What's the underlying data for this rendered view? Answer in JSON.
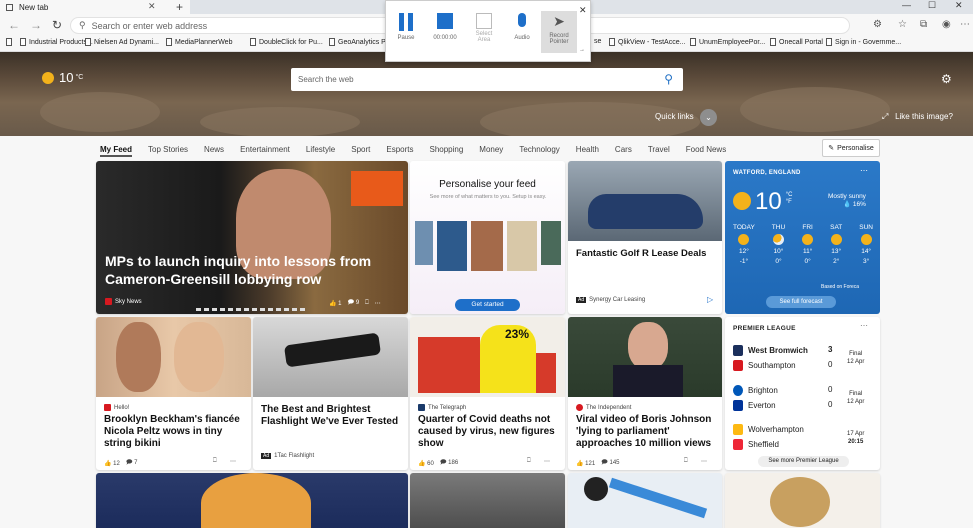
{
  "browser": {
    "tab_title": "New tab",
    "omnibox_placeholder": "Search or enter web address"
  },
  "favorites": [
    "Industrial Products...",
    "Nielsen Ad Dynami...",
    "MediaPlannerWeb",
    "DoubleClick for Pu...",
    "GeoAnalytics Plu",
    "se",
    "QlikView - TestAcce...",
    "UnumEmployeePor...",
    "Onecall Portal",
    "Sign in - Governme..."
  ],
  "recorder": {
    "pause": "Pause",
    "timer": "00:00:00",
    "select_area_1": "Select",
    "select_area_2": "Area",
    "audio": "Audio",
    "record_pointer_1": "Record",
    "record_pointer_2": "Pointer"
  },
  "header": {
    "temp": "10",
    "temp_unit": "°C",
    "search_placeholder": "Search the web",
    "quick_links": "Quick links",
    "like_image": "Like this image?"
  },
  "categories": [
    "My Feed",
    "Top Stories",
    "News",
    "Entertainment",
    "Lifestyle",
    "Sport",
    "Esports",
    "Shopping",
    "Money",
    "Technology",
    "Health",
    "Cars",
    "Travel",
    "Food News"
  ],
  "personalise": "Personalise",
  "cards": {
    "main": {
      "title": "MPs to launch inquiry into lessons from Cameron-Greensill lobbying row",
      "source": "Sky News",
      "likes": "1",
      "comments": "9"
    },
    "feed": {
      "title": "Personalise your feed",
      "sub": "See more of what matters to you. Setup is easy.",
      "button": "Get started"
    },
    "golf": {
      "title": "Fantastic Golf R Lease Deals",
      "ad": "Ad",
      "source": "Synergy Car Leasing"
    },
    "beckham": {
      "source": "Hello!",
      "title": "Brooklyn Beckham's fiancée Nicola Peltz wows in tiny string bikini",
      "likes": "12",
      "comments": "7"
    },
    "torch": {
      "title": "The Best and Brightest Flashlight We've Ever Tested",
      "ad": "Ad",
      "source": "1Tac Flashlight"
    },
    "covid": {
      "source": "The Telegraph",
      "title": "Quarter of Covid deaths not caused by virus, new figures show",
      "likes": "60",
      "comments": "186",
      "chart_text": "23%"
    },
    "boris": {
      "source": "The Independent",
      "title": "Viral video of Boris Johnson 'lying to parliament' approaches 10 million views",
      "likes": "121",
      "comments": "145"
    }
  },
  "weather": {
    "location": "WATFORD, ENGLAND",
    "temp": "10",
    "unit_c": "°C",
    "unit_f": "°F",
    "condition": "Mostly sunny",
    "precip": "16%",
    "forecast_label": "Based on Foreca",
    "button": "See full forecast",
    "days": [
      {
        "name": "TODAY",
        "hi": "12°",
        "lo": "-1°",
        "icon": "sun"
      },
      {
        "name": "THU",
        "hi": "10°",
        "lo": "0°",
        "icon": "cloud"
      },
      {
        "name": "FRI",
        "hi": "11°",
        "lo": "0°",
        "icon": "sun"
      },
      {
        "name": "SAT",
        "hi": "13°",
        "lo": "2°",
        "icon": "sun"
      },
      {
        "name": "SUN",
        "hi": "14°",
        "lo": "3°",
        "icon": "sun"
      }
    ]
  },
  "premier_league": {
    "title": "PREMIER LEAGUE",
    "button": "See more Premier League",
    "matches": [
      {
        "home": "West Bromwich",
        "away": "Southampton",
        "hs": "3",
        "as": "0",
        "status": "Final",
        "date": "12 Apr",
        "home_color": "#1b2f5c",
        "away_color": "#d71920"
      },
      {
        "home": "Brighton",
        "away": "Everton",
        "hs": "0",
        "as": "0",
        "status": "Final",
        "date": "12 Apr",
        "home_color": "#0057b8",
        "away_color": "#003399"
      },
      {
        "home": "Wolverhampton",
        "away": "Sheffield",
        "hs": "",
        "as": "",
        "status": "17 Apr",
        "date": "20:15",
        "home_color": "#fdb913",
        "away_color": "#ee2737"
      }
    ]
  }
}
